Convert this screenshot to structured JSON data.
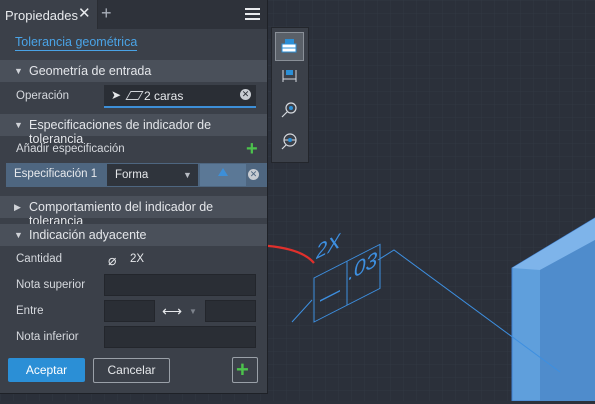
{
  "panel": {
    "tab_label": "Propiedades",
    "tab_close": "✕",
    "tab_add": "+",
    "title": "Tolerancia geométrica"
  },
  "sections": {
    "input_geometry": "Geometría de entrada",
    "indicator_specs": "Especificaciones de indicador de tolerancia",
    "indicator_behavior": "Comportamiento del indicador de tolerancia",
    "adjacent_indication": "Indicación adyacente"
  },
  "input_geometry": {
    "operation_label": "Operación",
    "operation_value": "2 caras"
  },
  "specs": {
    "add_label": "Añadir especificación",
    "row_label": "Especificación 1",
    "row_select_value": "Forma"
  },
  "adjacent": {
    "quantity_label": "Cantidad",
    "quantity_value": "2X",
    "upper_note_label": "Nota superior",
    "between_label": "Entre",
    "lower_note_label": "Nota inferior"
  },
  "buttons": {
    "accept": "Aceptar",
    "cancel": "Cancelar"
  },
  "annotation": {
    "quantity_text": "2X",
    "value_text": ".03"
  },
  "colors": {
    "accent": "#2b8fd6",
    "link": "#4aa3e6",
    "annotation": "#3d8fe0",
    "arrow": "#e0302c",
    "add_green": "#4cc24c"
  },
  "icons": {
    "tools": [
      "tolerance-feature-icon",
      "dimension-icon",
      "annotation-leader-icon",
      "datum-target-icon"
    ]
  }
}
